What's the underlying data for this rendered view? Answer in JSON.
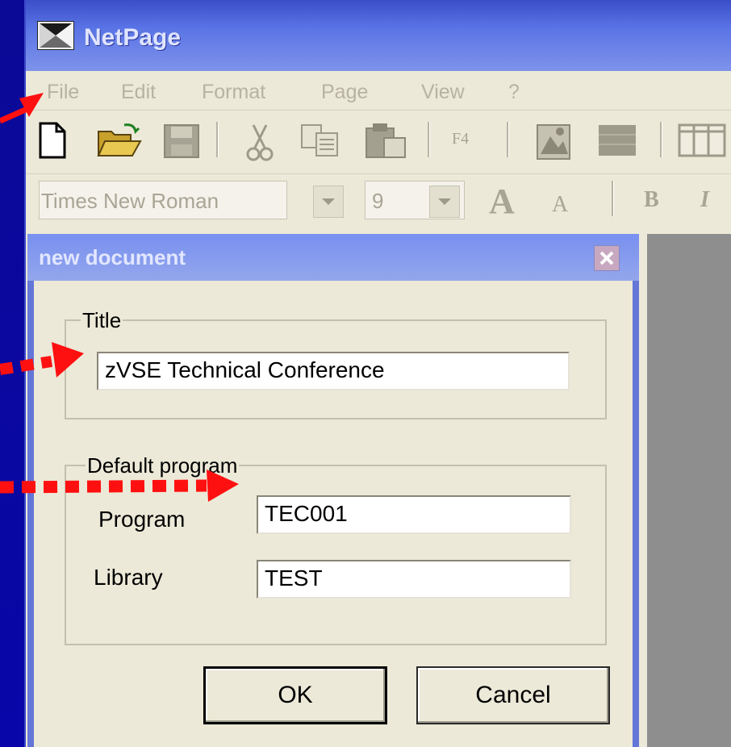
{
  "window": {
    "title": "NetPage",
    "app_icon": "netpage-app-icon"
  },
  "menu": {
    "items": [
      "File",
      "Edit",
      "Format",
      "Page",
      "View",
      "?"
    ]
  },
  "toolbar": {
    "icons": [
      "new-document-icon",
      "open-folder-icon",
      "save-disk-icon",
      "cut-scissors-icon",
      "copy-icon",
      "paste-icon",
      "f4-key-icon",
      "image-icon",
      "block-icon",
      "table-icon"
    ],
    "f4_label": "F4"
  },
  "format_toolbar": {
    "font_name": "Times New Roman",
    "font_size": "9",
    "bold_label": "B",
    "italic_label": "I",
    "grow_font_label": "A",
    "shrink_font_label": "A"
  },
  "dialog": {
    "title": "new document",
    "title_group": {
      "legend": "Title",
      "value": "zVSE Technical Conference"
    },
    "program_group": {
      "legend": "Default program",
      "program_label": "Program",
      "program_value": "TEC001",
      "library_label": "Library",
      "library_value": "TEST"
    },
    "ok_label": "OK",
    "cancel_label": "Cancel"
  },
  "colors": {
    "slide_background": "#0a0890",
    "annotation_arrows": "#ff1010",
    "window_face": "#ece9d8",
    "title_bar": "#5a74e6"
  }
}
